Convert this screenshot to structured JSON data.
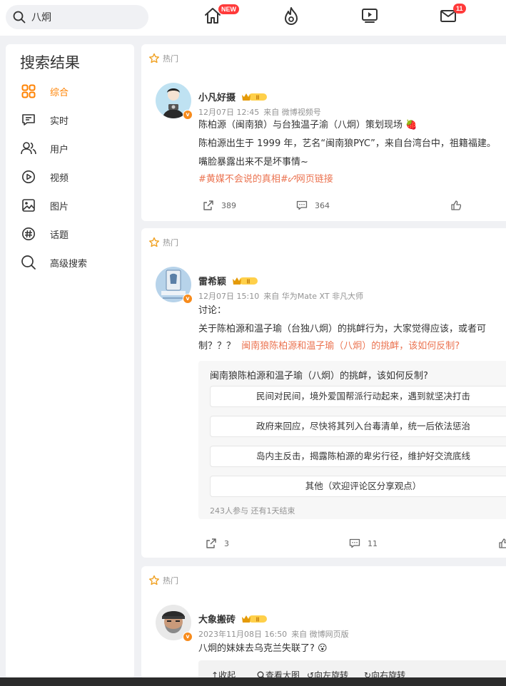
{
  "search": {
    "query": "八炯"
  },
  "nav": {
    "home_badge": "NEW",
    "mail_badge": "11"
  },
  "sidebar": {
    "title": "搜索结果",
    "items": [
      {
        "label": "综合",
        "icon": "grid-icon",
        "active": true
      },
      {
        "label": "实时",
        "icon": "chat-icon"
      },
      {
        "label": "用户",
        "icon": "users-icon"
      },
      {
        "label": "视频",
        "icon": "play-icon"
      },
      {
        "label": "图片",
        "icon": "image-icon"
      },
      {
        "label": "话题",
        "icon": "hashtag-icon"
      },
      {
        "label": "高级搜索",
        "icon": "search-icon"
      }
    ]
  },
  "colors": {
    "accent": "#ff8200",
    "link": "#eb7350",
    "badge": "#ff3a3a",
    "vip": "#f78b1c"
  },
  "posts": [
    {
      "hot_label": "热门",
      "user": "小凡好摄",
      "time": "12月07日 12:45",
      "source": "来自 微博视频号",
      "line1": "陈柏源（闽南狼）与台独温子渝（八炯）策划现场",
      "line2": "陈柏源出生于 1999 年，艺名“闽南狼PYC”，来自台湾台中，祖籍福建。",
      "line3": "嘴脸暴露出来不是坏事情~",
      "tag1": "#黄媒不会说的真相#",
      "tag2": "网页链接",
      "shares": "389",
      "comments": "364"
    },
    {
      "hot_label": "热门",
      "user": "雷希颖",
      "time": "12月07日 15:10",
      "source": "来自 华为Mate XT 非凡大师",
      "line1": "讨论：",
      "line2": "关于陈柏源和温子瑜（台独八炯）的挑衅行为，大家觉得应该，或者可",
      "line3_text": "制？？？",
      "line3_link": "闽南狼陈柏源和温子瑜（八炯）的挑衅，该如何反制?",
      "poll": {
        "question": "闽南狼陈柏源和温子瑜（八炯）的挑衅，该如何反制?",
        "options": [
          "民间对民间，境外爱国帮派行动起来，遇到就坚决打击",
          "政府来回应，尽快将其列入台毒清单，统一后依法惩治",
          "岛内主反击，揭露陈柏源的卑劣行径，维护好交流底线",
          "其他（欢迎评论区分享观点）"
        ],
        "footer": "243人参与 还有1天结束"
      },
      "shares": "3",
      "comments": "11"
    },
    {
      "hot_label": "热门",
      "user": "大象搬砖",
      "time": "2023年11月08日 16:50",
      "source": "来自 微博网页版",
      "line1": "八炯的妹妹去乌克兰失联了?",
      "image_actions": [
        "收起",
        "查看大图",
        "向左旋转",
        "向右旋转"
      ]
    }
  ]
}
